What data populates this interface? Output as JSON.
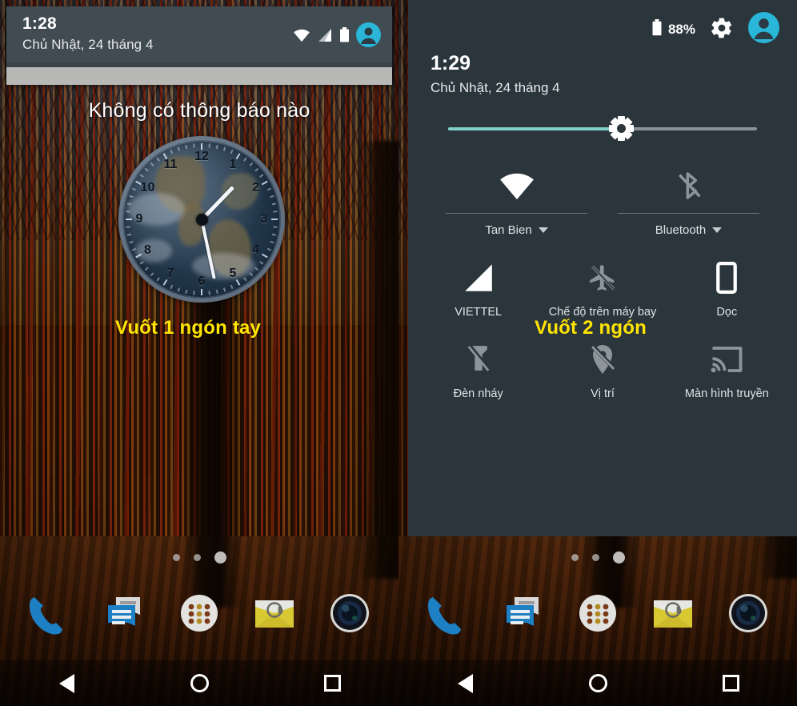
{
  "left_panel": {
    "notification_shade": {
      "time": "1:28",
      "date": "Chủ Nhật, 24 tháng 4",
      "status_icons": [
        "wifi-icon",
        "cellular-signal-icon",
        "battery-icon",
        "user-avatar-icon"
      ]
    },
    "no_notifications_text": "Không có thông báo nào",
    "clock_widget": {
      "name": "earth-analog-clock",
      "hour_numbers": [
        "12",
        "1",
        "2",
        "3",
        "4",
        "5",
        "6",
        "7",
        "8",
        "9",
        "10",
        "11"
      ],
      "hour_hand_deg": 44,
      "minute_hand_deg": 168
    },
    "annotation": "Vuốt 1 ngón tay"
  },
  "right_panel": {
    "quick_settings": {
      "battery_percent": "88%",
      "time": "1:29",
      "date": "Chủ Nhật, 24 tháng 4",
      "brightness": {
        "name": "brightness-slider",
        "value": 56
      },
      "duo_tiles": [
        {
          "label": "Tan Bien",
          "icon": "wifi-icon",
          "enabled": true
        },
        {
          "label": "Bluetooth",
          "icon": "bluetooth-off-icon",
          "enabled": false
        }
      ],
      "tiles": [
        {
          "label": "VIETTEL",
          "icon": "cellular-signal-icon",
          "enabled": true
        },
        {
          "label": "Chế độ trên máy bay",
          "icon": "airplane-off-icon",
          "enabled": false
        },
        {
          "label": "Dọc",
          "icon": "rotation-portrait-icon",
          "enabled": true
        },
        {
          "label": "Đèn nháy",
          "icon": "flashlight-off-icon",
          "enabled": false
        },
        {
          "label": "Vị trí",
          "icon": "location-off-icon",
          "enabled": false
        },
        {
          "label": "Màn hình truyền",
          "icon": "cast-screen-icon",
          "enabled": false
        }
      ],
      "header_icons": [
        "battery-icon",
        "settings-gear-icon",
        "user-avatar-icon"
      ]
    },
    "annotation": "Vuốt 2 ngón"
  },
  "dock": {
    "apps": [
      {
        "name": "phone-app-icon"
      },
      {
        "name": "messages-app-icon"
      },
      {
        "name": "app-drawer-icon"
      },
      {
        "name": "email-app-icon"
      },
      {
        "name": "camera-app-icon"
      }
    ]
  },
  "home_indicator": {
    "pages": 3,
    "active_index": 2
  },
  "navbar": {
    "buttons": [
      {
        "name": "back-button"
      },
      {
        "name": "home-button"
      },
      {
        "name": "recents-button"
      }
    ]
  },
  "colors": {
    "panel_bg": "#2b353c",
    "shade_bg": "#404b52",
    "accent_cyan": "#29b6d8",
    "annotation_yellow": "#ffe500",
    "slider_fill": "#7fd0c6"
  }
}
